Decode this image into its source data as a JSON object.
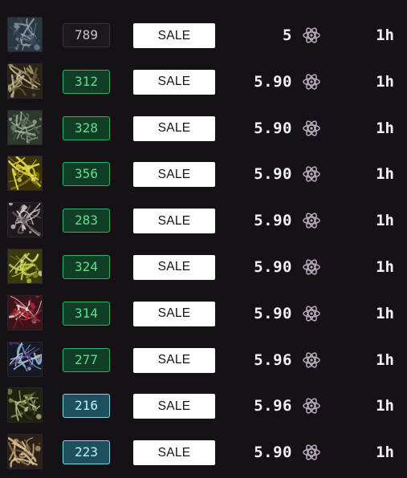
{
  "colors": {
    "background": "#151116",
    "rank_gray": "#c9c6cc",
    "rank_green": "#5fe08d",
    "rank_cyan": "#bff0fb",
    "coin": "#b8b0bf"
  },
  "currency_icon": "atom-icon",
  "listings": [
    {
      "rank": "789",
      "rank_style": "gray",
      "button": "SALE",
      "price": "5",
      "time": "1h",
      "thumb": [
        "#2a3640",
        "#6f8aa0",
        "#9aa4b0",
        "#3c4a5a"
      ]
    },
    {
      "rank": "312",
      "rank_style": "green",
      "button": "SALE",
      "price": "5.90",
      "time": "1h",
      "thumb": [
        "#2a2418",
        "#cfc7a8",
        "#6b5a3a",
        "#a89870"
      ]
    },
    {
      "rank": "328",
      "rank_style": "green",
      "button": "SALE",
      "price": "5.90",
      "time": "1h",
      "thumb": [
        "#2e3a30",
        "#6e8a6a",
        "#a9b8a4",
        "#4a5c48"
      ]
    },
    {
      "rank": "356",
      "rank_style": "green",
      "button": "SALE",
      "price": "5.90",
      "time": "1h",
      "thumb": [
        "#3a3408",
        "#d9d22a",
        "#8a7a10",
        "#f0e860"
      ]
    },
    {
      "rank": "283",
      "rank_style": "green",
      "button": "SALE",
      "price": "5.90",
      "time": "1h",
      "thumb": [
        "#1e1a1c",
        "#c9c4c4",
        "#6a5a5e",
        "#e2dcdc"
      ]
    },
    {
      "rank": "324",
      "rank_style": "green",
      "button": "SALE",
      "price": "5.90",
      "time": "1h",
      "thumb": [
        "#3a3a10",
        "#c8d050",
        "#8a9a2a",
        "#e0e878"
      ]
    },
    {
      "rank": "314",
      "rank_style": "green",
      "button": "SALE",
      "price": "5.90",
      "time": "1h",
      "thumb": [
        "#3a1418",
        "#e8e0e0",
        "#b82a3a",
        "#7a2030"
      ]
    },
    {
      "rank": "277",
      "rank_style": "green",
      "button": "SALE",
      "price": "5.96",
      "time": "1h",
      "thumb": [
        "#141a24",
        "#7ab0e0",
        "#b8c8d8",
        "#5a3a7a"
      ]
    },
    {
      "rank": "216",
      "rank_style": "cyan",
      "button": "SALE",
      "price": "5.96",
      "time": "1h",
      "thumb": [
        "#1e2210",
        "#8a9050",
        "#c0c890",
        "#4a4e28"
      ]
    },
    {
      "rank": "223",
      "rank_style": "cyan",
      "button": "SALE",
      "price": "5.90",
      "time": "1h",
      "thumb": [
        "#2a2018",
        "#c8a878",
        "#8a6a48",
        "#e0c8a0"
      ]
    }
  ]
}
